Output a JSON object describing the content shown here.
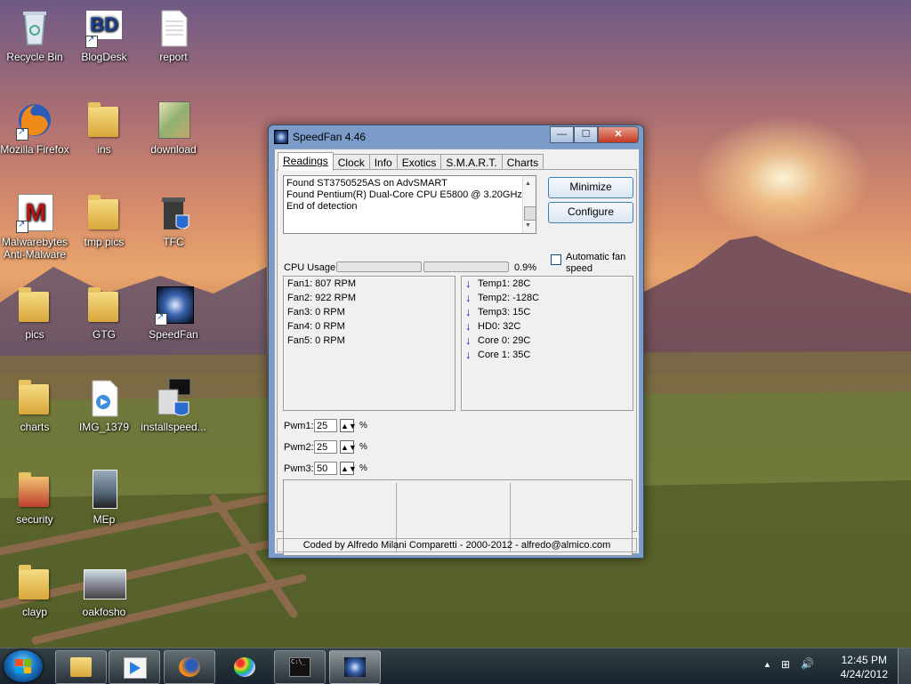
{
  "desktop": {
    "icons": [
      {
        "label": "Recycle Bin"
      },
      {
        "label": "BlogDesk"
      },
      {
        "label": "report"
      },
      {
        "label": "Mozilla Firefox"
      },
      {
        "label": "ins"
      },
      {
        "label": "download"
      },
      {
        "label": "Malwarebytes Anti-Malware"
      },
      {
        "label": "tmp pics"
      },
      {
        "label": "TFC"
      },
      {
        "label": "pics"
      },
      {
        "label": "GTG"
      },
      {
        "label": "SpeedFan"
      },
      {
        "label": "charts"
      },
      {
        "label": "IMG_1379"
      },
      {
        "label": "installspeed..."
      },
      {
        "label": "security"
      },
      {
        "label": "MEp"
      },
      {
        "label": "clayp"
      },
      {
        "label": "oakfosho"
      }
    ],
    "blogdesk_logo": "BD"
  },
  "window": {
    "title": "SpeedFan 4.46",
    "buttons": {
      "minimize": "—",
      "maximize": "☐",
      "close": "✕"
    },
    "tabs": [
      "Readings",
      "Clock",
      "Info",
      "Exotics",
      "S.M.A.R.T.",
      "Charts"
    ],
    "active_tab": "Readings",
    "log_lines": [
      "Found ST3750525AS on AdvSMART",
      "Found Pentium(R) Dual-Core CPU E5800 @ 3.20GHz",
      "End of detection"
    ],
    "minimize_button": "Minimize",
    "configure_button": "Configure",
    "auto_fan_label": "Automatic fan speed",
    "auto_fan_checked": false,
    "cpu_usage_label": "CPU Usage",
    "cpu_usage_value": "0.9%",
    "fans": [
      "Fan1: 807 RPM",
      "Fan2: 922 RPM",
      "Fan3: 0 RPM",
      "Fan4: 0 RPM",
      "Fan5: 0 RPM"
    ],
    "temps": [
      {
        "label": "Temp1: 28C"
      },
      {
        "label": "Temp2: -128C"
      },
      {
        "label": "Temp3: 15C"
      },
      {
        "label": "HD0:    32C"
      },
      {
        "label": "Core 0:  29C"
      },
      {
        "label": "Core 1:  35C"
      }
    ],
    "pwm": [
      {
        "label": "Pwm1:",
        "value": "25",
        "unit": "%"
      },
      {
        "label": "Pwm2:",
        "value": "25",
        "unit": "%"
      },
      {
        "label": "Pwm3:",
        "value": "50",
        "unit": "%"
      }
    ],
    "status_bar": "Coded by Alfredo Milani Comparetti - 2000-2012 - alfredo@almico.com"
  },
  "taskbar": {
    "time": "12:45 PM",
    "date": "4/24/2012",
    "cmd_glyph": "C:\\_"
  },
  "colors": {
    "window_frame": "#7b9cc9",
    "temp_arrow": "#0b2a9a",
    "close_button": "#c23a1f"
  }
}
